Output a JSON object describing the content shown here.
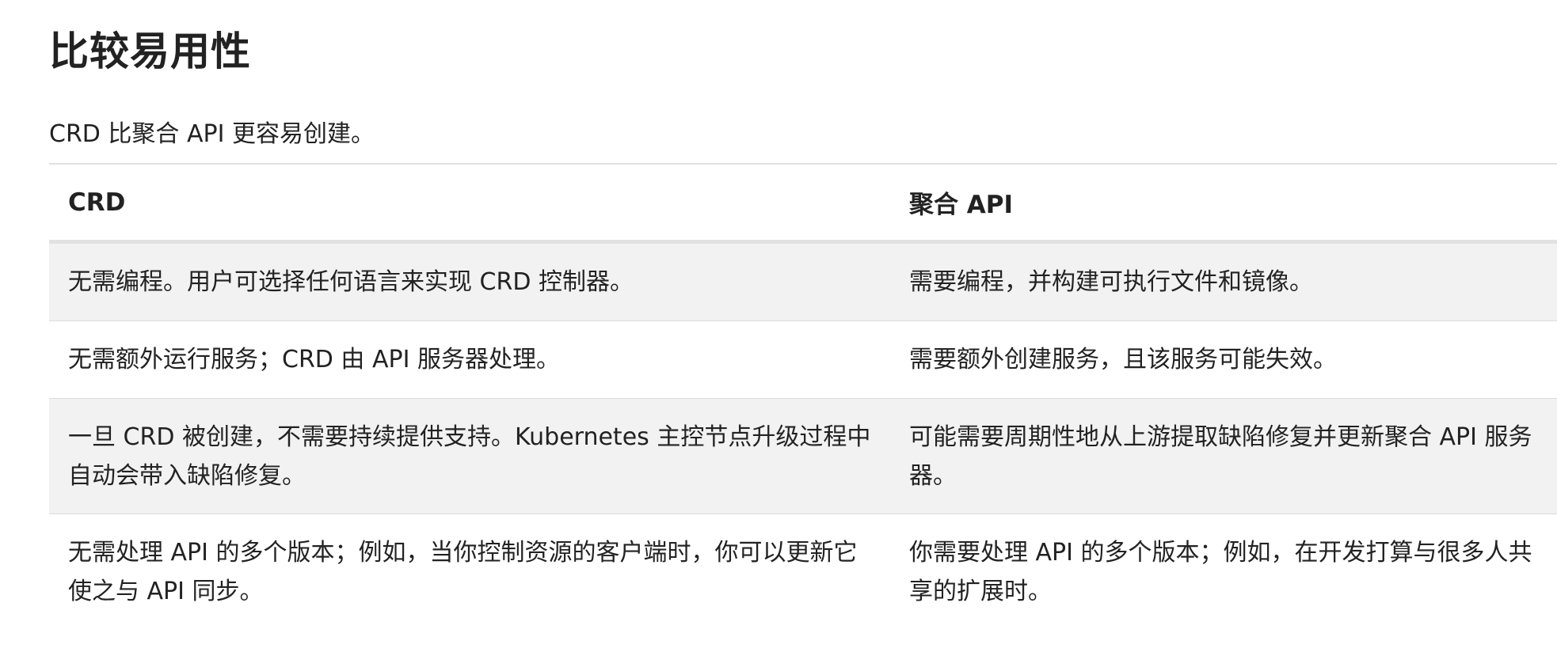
{
  "section": {
    "title": "比较易用性",
    "intro": "CRD 比聚合 API 更容易创建。"
  },
  "table": {
    "headers": [
      "CRD",
      "聚合 API"
    ],
    "rows": [
      {
        "crd": "无需编程。用户可选择任何语言来实现 CRD 控制器。",
        "aggregated": "需要编程，并构建可执行文件和镜像。"
      },
      {
        "crd": "无需额外运行服务；CRD 由 API 服务器处理。",
        "aggregated": "需要额外创建服务，且该服务可能失效。"
      },
      {
        "crd": "一旦 CRD 被创建，不需要持续提供支持。Kubernetes 主控节点升级过程中自动会带入缺陷修复。",
        "aggregated": "可能需要周期性地从上游提取缺陷修复并更新聚合 API 服务器。"
      },
      {
        "crd": "无需处理 API 的多个版本；例如，当你控制资源的客户端时，你可以更新它使之与 API 同步。",
        "aggregated": "你需要处理 API 的多个版本；例如，在开发打算与很多人共享的扩展时。"
      }
    ]
  }
}
